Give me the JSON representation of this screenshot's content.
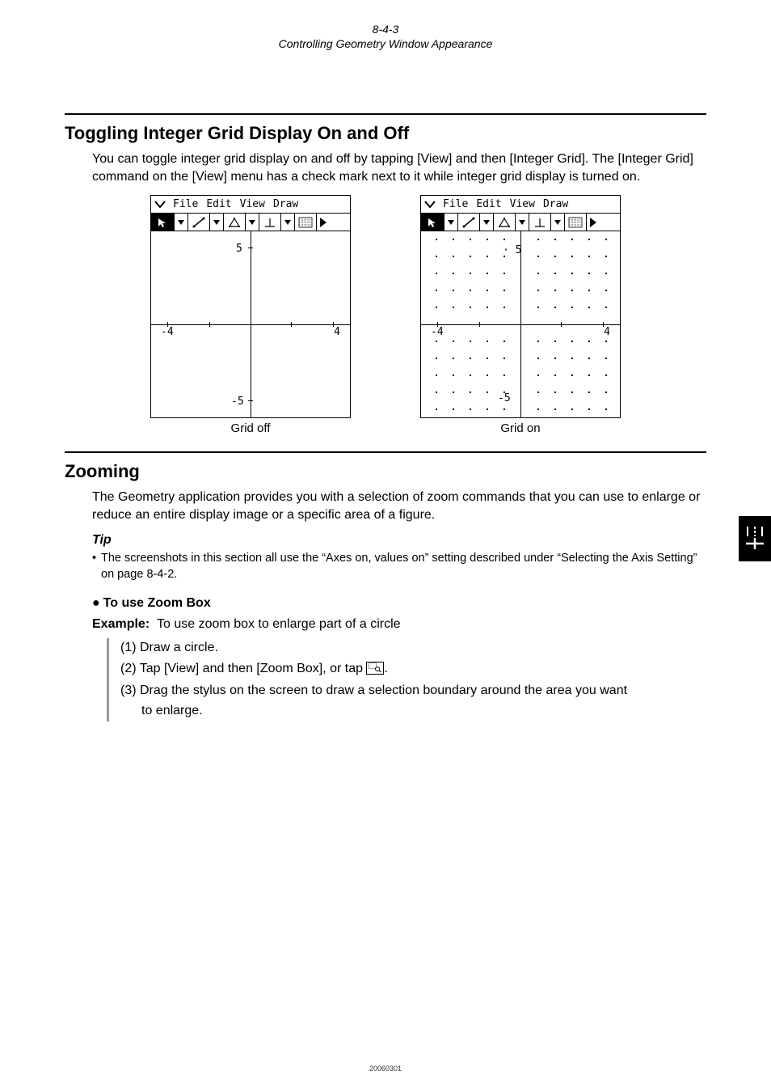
{
  "header": {
    "page_ref": "8-4-3",
    "page_title": "Controlling Geometry Window Appearance"
  },
  "section1": {
    "heading": "Toggling Integer Grid Display On and Off",
    "para": "You can toggle integer grid display on and off by tapping [View] and then [Integer Grid]. The [Integer Grid] command on the [View] menu has a check mark next to it while integer grid display is turned on."
  },
  "menus": {
    "file": "File",
    "edit": "Edit",
    "view": "View",
    "draw": "Draw"
  },
  "axis_labels": {
    "pos5": "5",
    "neg5": "-5",
    "neg4": "-4",
    "pos4": "4",
    "dot5": "· 5"
  },
  "captions": {
    "grid_off": "Grid off",
    "grid_on": "Grid on"
  },
  "section2": {
    "heading": "Zooming",
    "para": "The Geometry application provides you with a selection of zoom commands that you can use to enlarge or reduce an entire display image or a specific area of a figure."
  },
  "tip": {
    "heading": "Tip",
    "item": "The screenshots in this section all use the “Axes on, values on” setting described under “Selecting the Axis Setting” on page 8-4-2."
  },
  "subhead": {
    "label": "To use Zoom Box"
  },
  "example": {
    "label": "Example:",
    "text": "To use zoom box to enlarge part of a circle"
  },
  "steps": {
    "s1": "(1) Draw a circle.",
    "s2a": "(2) Tap [View] and then [Zoom Box], or tap ",
    "s2b": ".",
    "s3a": "(3) Drag the stylus on the screen to draw a selection boundary around the area you want",
    "s3b": "to enlarge."
  },
  "footer": {
    "code": "20060301"
  }
}
